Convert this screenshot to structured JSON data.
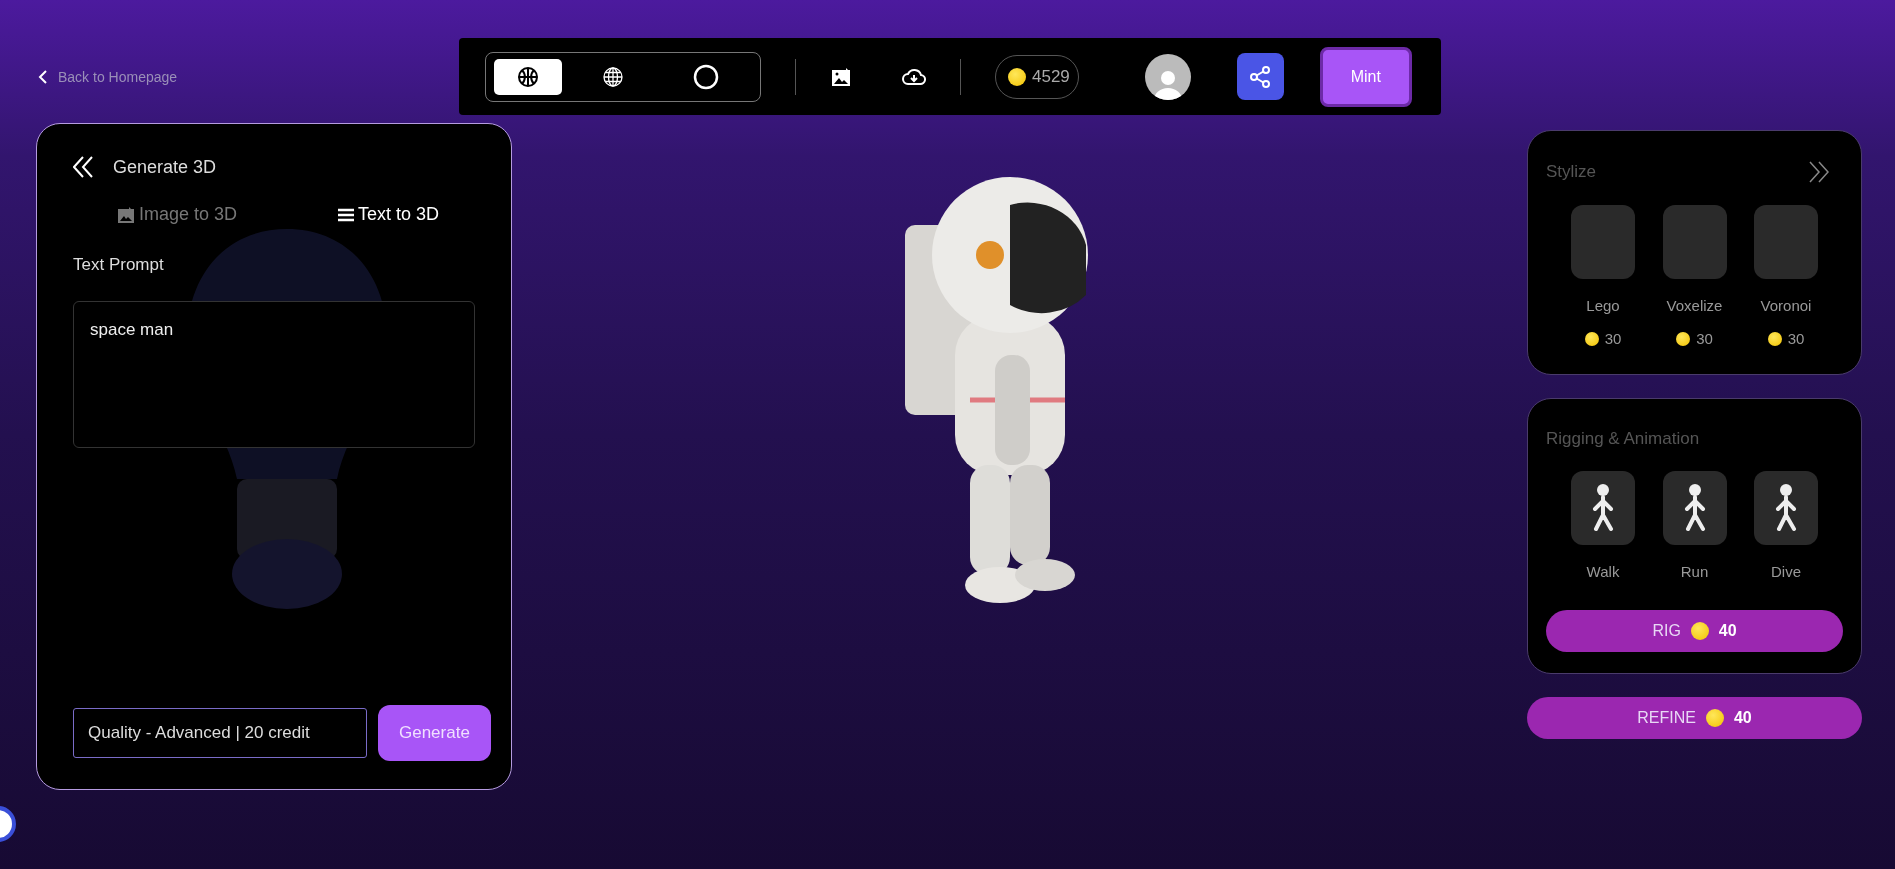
{
  "back_link": {
    "label": "Back to Homepage"
  },
  "toolbar": {
    "view_modes": [
      {
        "kind": "ball",
        "selected": true
      },
      {
        "kind": "globe",
        "selected": false
      },
      {
        "kind": "ring",
        "selected": false
      }
    ],
    "credits": "4529",
    "mint_button": "Mint"
  },
  "generate_panel": {
    "title": "Generate 3D",
    "tabs": [
      {
        "kind": "image",
        "label": "Image to 3D",
        "selected": false
      },
      {
        "kind": "text",
        "label": "Text to 3D",
        "selected": true
      }
    ],
    "prompt_label": "Text Prompt",
    "prompt_value": "space man",
    "quality": "Quality - Advanced | 20 credit",
    "generate_button": "Generate"
  },
  "stylize": {
    "title": "Stylize",
    "styles": [
      {
        "name": "Lego",
        "cost": "30"
      },
      {
        "name": "Voxelize",
        "cost": "30"
      },
      {
        "name": "Voronoi",
        "cost": "30"
      }
    ]
  },
  "rigging": {
    "title": "Rigging & Animation",
    "animations": [
      {
        "name": "Walk"
      },
      {
        "name": "Run"
      },
      {
        "name": "Dive"
      }
    ],
    "rig_button": {
      "label": "RIG",
      "cost": "40"
    }
  },
  "refine_button": {
    "label": "REFINE",
    "cost": "40"
  }
}
